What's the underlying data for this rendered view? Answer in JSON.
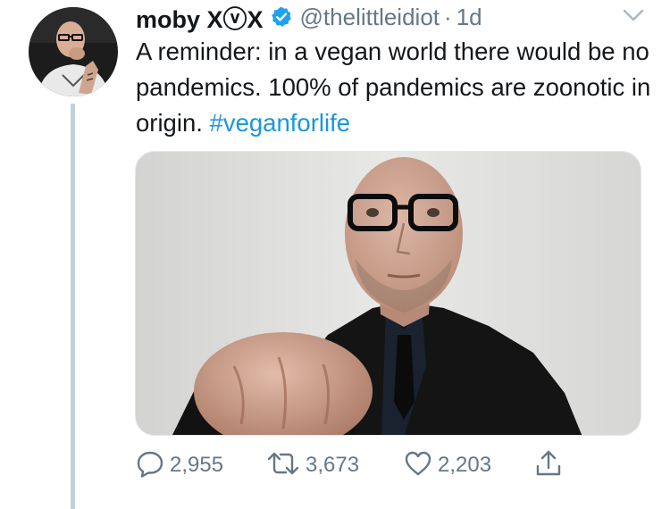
{
  "tweet": {
    "display_name": "moby XⓥX",
    "handle": "@thelittleidiot",
    "separator": "·",
    "time": "1d",
    "text_main": "A reminder: in a vegan world there would be no pandemics. 100% of pandemics are zoonotic in origin.",
    "hashtag": "#veganforlife",
    "verified": true
  },
  "actions": {
    "reply_count": "2,955",
    "retweet_count": "3,673",
    "like_count": "2,203"
  },
  "icons": {
    "avatar": "avatar",
    "verified": "verified-badge-icon",
    "caret": "chevron-down-icon",
    "reply": "reply-icon",
    "retweet": "retweet-icon",
    "like": "heart-icon",
    "share": "share-icon"
  },
  "colors": {
    "accent": "#1da1f2",
    "hashtag": "#1b95e0",
    "muted": "#657786",
    "text": "#14171a",
    "thread_line": "#c4d0d9"
  }
}
